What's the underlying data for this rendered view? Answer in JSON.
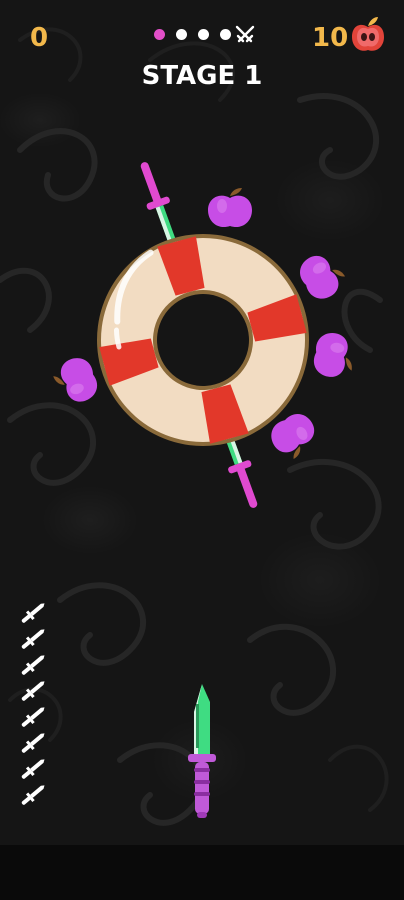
{
  "hud": {
    "score": "0",
    "apple_count": "10",
    "stage_title": "STAGE 1",
    "stage_progress": {
      "dots": [
        {
          "state": "current"
        },
        {
          "state": "upcoming"
        },
        {
          "state": "upcoming"
        },
        {
          "state": "upcoming"
        }
      ],
      "boss_icon": "crossed-swords-icon"
    }
  },
  "target": {
    "type": "lifebuoy",
    "colors": {
      "cream": "#f2dcc2",
      "red": "#e2382a",
      "outline": "#8a6a3a"
    },
    "apples": 5,
    "stuck_knives": 2
  },
  "knives_remaining": {
    "count": 8,
    "icon": "knife-silhouette-icon"
  },
  "player_knife": {
    "blade_color": "#4be07f",
    "handle_color": "#c05ad8"
  },
  "colors": {
    "accent": "#f2b84b",
    "apple": "#c74de6",
    "stage_dot_active": "#e24fc8"
  }
}
